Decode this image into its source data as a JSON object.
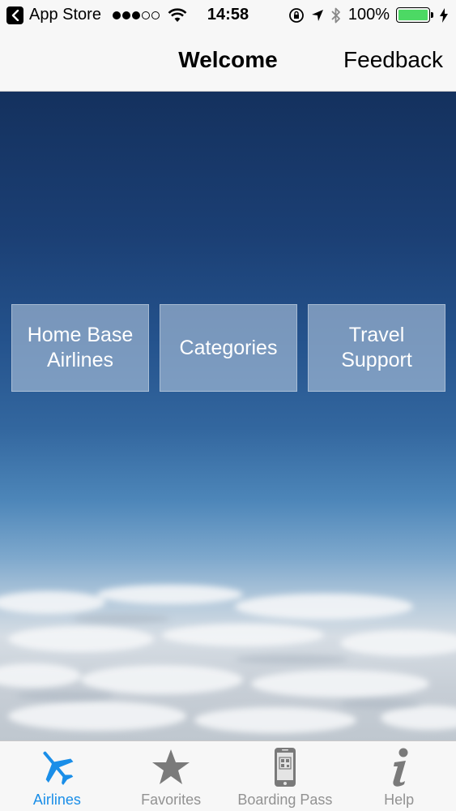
{
  "status_bar": {
    "back_app": "App Store",
    "time": "14:58",
    "battery": "100%",
    "battery_level": 1.0,
    "signal_bars_filled": 3,
    "signal_bars_total": 5
  },
  "nav": {
    "title": "Welcome",
    "right_button": "Feedback"
  },
  "main": {
    "tiles": [
      {
        "label_line1": "Home Base",
        "label_line2": "Airlines"
      },
      {
        "label_line1": "Categories",
        "label_line2": ""
      },
      {
        "label_line1": "Travel",
        "label_line2": "Support"
      }
    ]
  },
  "tab_bar": {
    "active_color": "#1a8ee8",
    "inactive_color": "#929292",
    "tabs": [
      {
        "label": "Airlines",
        "icon": "airplane-icon",
        "active": true
      },
      {
        "label": "Favorites",
        "icon": "star-icon",
        "active": false
      },
      {
        "label": "Boarding Pass",
        "icon": "phone-qr-icon",
        "active": false
      },
      {
        "label": "Help",
        "icon": "info-icon",
        "active": false
      }
    ]
  }
}
